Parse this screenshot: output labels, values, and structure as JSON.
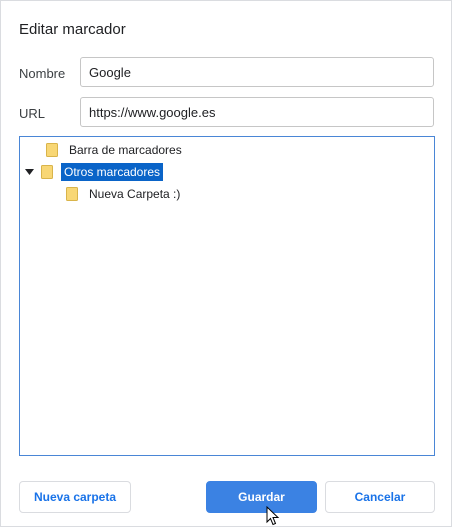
{
  "dialog": {
    "title": "Editar marcador",
    "name_label": "Nombre",
    "name_value": "Google",
    "url_label": "URL",
    "url_value": "https://www.google.es"
  },
  "tree": {
    "items": [
      {
        "label": "Barra de marcadores",
        "expanded": false,
        "selected": false
      },
      {
        "label": "Otros marcadores",
        "expanded": true,
        "selected": true
      },
      {
        "label": "Nueva Carpeta :)",
        "expanded": false,
        "selected": false
      }
    ]
  },
  "buttons": {
    "new_folder": "Nueva carpeta",
    "save": "Guardar",
    "cancel": "Cancelar"
  },
  "colors": {
    "accent": "#3b82e3",
    "selection": "#0a64c8",
    "folder": "#f8d775"
  }
}
